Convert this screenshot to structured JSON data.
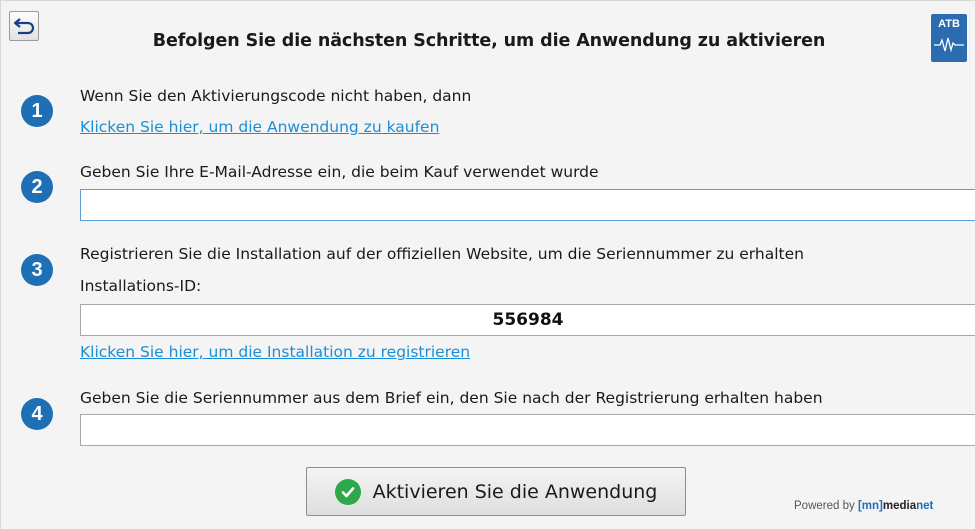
{
  "header": {
    "title": "Befolgen Sie die nächsten Schritte, um die Anwendung zu aktivieren",
    "logo_text": "ATB"
  },
  "steps": [
    {
      "number": "1",
      "text": "Wenn Sie den Aktivierungscode nicht haben, dann",
      "link": "Klicken Sie hier, um die Anwendung zu kaufen"
    },
    {
      "number": "2",
      "text": "Geben Sie Ihre E-Mail-Adresse ein, die beim Kauf verwendet wurde",
      "email_value": ""
    },
    {
      "number": "3",
      "text": "Registrieren Sie die Installation auf der offiziellen Website, um die Seriennummer zu erhalten",
      "installation_label": "Installations-ID:",
      "installation_id": "556984",
      "link": "Klicken Sie hier, um die Installation zu registrieren"
    },
    {
      "number": "4",
      "text": "Geben Sie die Seriennummer aus dem Brief ein, den Sie nach der Registrierung erhalten haben",
      "serial_value": ""
    }
  ],
  "activate_button": {
    "label": "Aktivieren Sie die Anwendung"
  },
  "footer": {
    "powered_by": "Powered by",
    "brand_bracket_open": "[",
    "brand_mn": "mn",
    "brand_bracket_close": "]",
    "brand_media": "media",
    "brand_net": "net"
  },
  "colors": {
    "accent": "#1e6fb6",
    "link": "#1a8fd6",
    "success": "#2ea84b",
    "background": "#f4f4f4"
  },
  "icons": {
    "back": "back-arrow-icon",
    "logo": "atb-logo-icon",
    "activate": "check-circle-icon"
  }
}
